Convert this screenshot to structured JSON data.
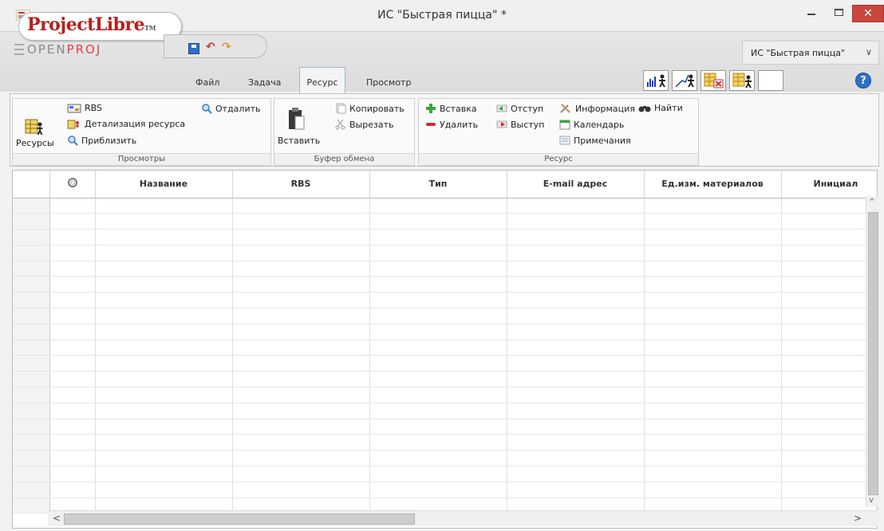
{
  "window": {
    "title": "ИС \"Быстрая пицца\" *",
    "min_label": "–",
    "close_label": "✕"
  },
  "logo": {
    "brand": "ProjectLibre",
    "tm": "TM",
    "sub_a": "OPEN",
    "sub_b": "PROJ"
  },
  "project_selector": {
    "value": "ИС \"Быстрая пицца\"",
    "chevron": "∨"
  },
  "menu": {
    "file": "Файл",
    "task": "Задача",
    "resource": "Ресурс",
    "view": "Просмотр"
  },
  "help_label": "?",
  "ribbon": {
    "views": {
      "resources": "Ресурсы",
      "rbs": "RBS",
      "resource_detail": "Детализация ресурса",
      "zoom_in": "Приблизить",
      "zoom_out": "Отдалить",
      "label": "Просмотры"
    },
    "clipboard": {
      "paste": "Вставить",
      "copy": "Копировать",
      "cut": "Вырезать",
      "label": "Буфер обмена"
    },
    "resource": {
      "insert": "Вставка",
      "delete": "Удалить",
      "indent": "Отступ",
      "outdent": "Выступ",
      "info": "Информация",
      "calendar": "Календарь",
      "notes": "Примечания",
      "find": "Найти",
      "label": "Ресурс"
    }
  },
  "grid": {
    "columns": [
      "Название",
      "RBS",
      "Тип",
      "E-mail адрес",
      "Ед.изм. материалов",
      "Инициал"
    ],
    "indicator_icon": "indicators-icon"
  },
  "scroll": {
    "up": "^",
    "down": "v",
    "left": "<",
    "right": ">"
  }
}
